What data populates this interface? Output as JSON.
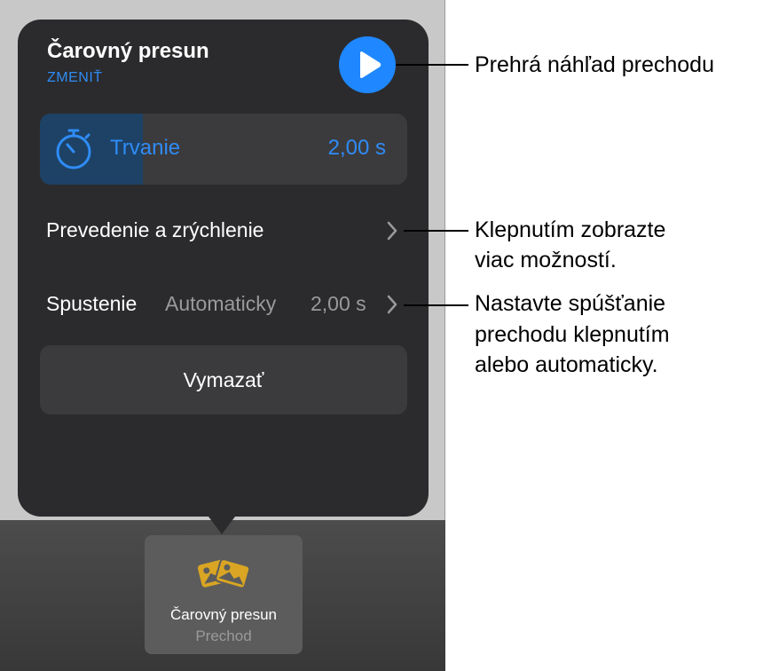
{
  "popover": {
    "title": "Čarovný presun",
    "change_label": "ZMENIŤ",
    "duration": {
      "label": "Trvanie",
      "value": "2,00 s",
      "fill_fraction": 0.28
    },
    "easing_label": "Prevedenie a zrýchlenie",
    "start": {
      "label": "Spustenie",
      "mode": "Automaticky",
      "delay": "2,00 s"
    },
    "delete_label": "Vymazať"
  },
  "tile": {
    "name": "Čarovný presun",
    "subtitle": "Prechod"
  },
  "callouts": {
    "play": "Prehrá náhľad prechodu",
    "more_line1": "Klepnutím zobrazte",
    "more_line2": "viac možností.",
    "start_line1": "Nastavte spúšťanie",
    "start_line2": "prechodu klepnutím",
    "start_line3": "alebo automaticky."
  },
  "colors": {
    "accent": "#1f87ff",
    "popover_bg": "#2b2b2d",
    "row_bg": "#3b3b3e",
    "tile_icon": "#d9a523"
  },
  "icons": {
    "play": "play-icon",
    "timer": "stopwatch-icon",
    "chevron": "chevron-right-icon",
    "tile": "photos-swap-icon"
  }
}
